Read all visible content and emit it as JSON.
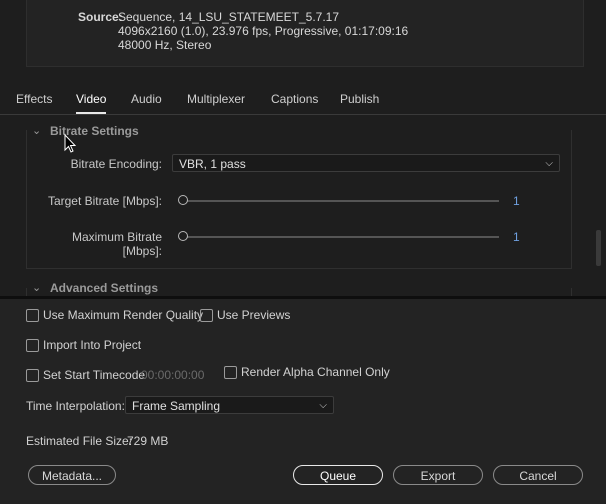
{
  "source": {
    "label": "Source:",
    "line1": "Sequence, 14_LSU_STATEMEET_5.7.17",
    "line2": "4096x2160 (1.0), 23.976 fps, Progressive, 01:17:09:16",
    "line3": "48000 Hz, Stereo"
  },
  "tabs": [
    {
      "label": "Effects"
    },
    {
      "label": "Video"
    },
    {
      "label": "Audio"
    },
    {
      "label": "Multiplexer"
    },
    {
      "label": "Captions"
    },
    {
      "label": "Publish"
    }
  ],
  "active_tab": "Video",
  "bitrate": {
    "title": "Bitrate Settings",
    "encoding_label": "Bitrate Encoding:",
    "encoding_value": "VBR, 1 pass",
    "target_label": "Target Bitrate [Mbps]:",
    "target_value": "1",
    "max_label": "Maximum Bitrate [Mbps]:",
    "max_value": "1"
  },
  "advanced": {
    "title": "Advanced Settings"
  },
  "options": {
    "max_render_quality": "Use Maximum Render Quality",
    "use_previews": "Use Previews",
    "import_into_project": "Import Into Project",
    "set_start_timecode": "Set Start Timecode",
    "start_timecode_value": "00:00:00:00",
    "render_alpha": "Render Alpha Channel Only"
  },
  "interpolation": {
    "label": "Time Interpolation:",
    "value": "Frame Sampling"
  },
  "file_size": {
    "label": "Estimated File Size:",
    "value": "729 MB"
  },
  "buttons": {
    "metadata": "Metadata...",
    "queue": "Queue",
    "export": "Export",
    "cancel": "Cancel"
  },
  "colors": {
    "background": "#1e1e1e",
    "panel": "#232323",
    "slider_value": "#6fa0e0"
  }
}
